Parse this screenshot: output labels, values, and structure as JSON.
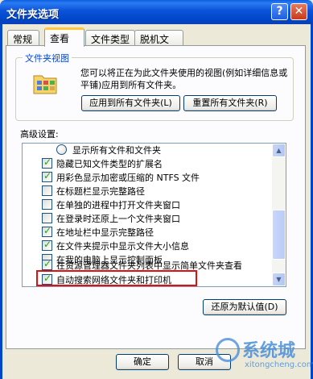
{
  "window": {
    "title": "文件夹选项",
    "help_label": "?",
    "close_label": "✕"
  },
  "tabs": [
    {
      "label": "常规",
      "active": false
    },
    {
      "label": "查看",
      "active": true
    },
    {
      "label": "文件类型",
      "active": false
    },
    {
      "label": "脱机文件",
      "active": false
    }
  ],
  "folder_views": {
    "title": "文件夹视图",
    "description": "您可以将正在为此文件夹使用的视图(例如详细信息或平铺)应用到所有文件夹。",
    "apply_all_label": "应用到所有文件夹(L)",
    "reset_all_label": "重置所有文件夹(R)"
  },
  "advanced": {
    "label": "高级设置:",
    "items": [
      {
        "type": "radio",
        "text": "显示所有文件和文件夹",
        "checked": false
      },
      {
        "type": "checkbox",
        "text": "隐藏已知文件类型的扩展名",
        "checked": true
      },
      {
        "type": "checkbox",
        "text": "用彩色显示加密或压缩的 NTFS 文件",
        "checked": true
      },
      {
        "type": "checkbox",
        "text": "在标题栏显示完整路径",
        "checked": false
      },
      {
        "type": "checkbox",
        "text": "在单独的进程中打开文件夹窗口",
        "checked": false
      },
      {
        "type": "checkbox",
        "text": "在登录时还原上一个文件夹窗口",
        "checked": false
      },
      {
        "type": "checkbox",
        "text": "在地址栏中显示完整路径",
        "checked": true
      },
      {
        "type": "checkbox",
        "text": "在文件夹提示中显示文件大小信息",
        "checked": true
      },
      {
        "type": "checkbox",
        "text": "在我的电脑上显示控制面板",
        "checked": false
      },
      {
        "type": "checkbox",
        "text": "在资源管理器文件夹列表中显示简单文件夹查看",
        "checked": true
      },
      {
        "type": "checkbox",
        "text": "自动搜索网络文件夹和打印机",
        "checked": true
      }
    ],
    "restore_label": "还原为默认值(D)"
  },
  "footer": {
    "ok_label": "确定",
    "cancel_label": "取消"
  },
  "watermark": {
    "text": "系统城",
    "sub": "xitongcheng.com"
  },
  "colors": {
    "accent": "#0046d5",
    "highlight": "#e01010"
  }
}
